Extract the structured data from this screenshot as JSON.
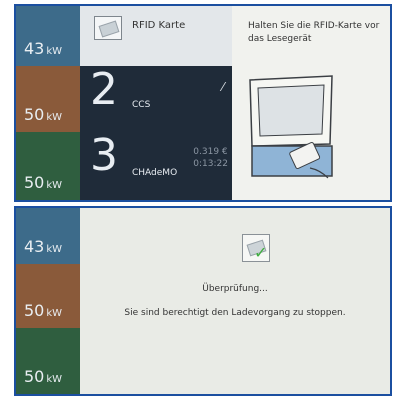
{
  "top": {
    "rows": [
      {
        "kw": "43",
        "unit": "kW",
        "color": "#3d6b8a"
      },
      {
        "kw": "50",
        "unit": "kW",
        "color": "#8a5a3a"
      },
      {
        "kw": "50",
        "unit": "kW",
        "color": "#2f5e3f"
      }
    ],
    "header_label": "RFID Karte",
    "connectors": [
      {
        "number": "2",
        "type": "CCS",
        "value": "⁄"
      },
      {
        "number": "3",
        "type": "CHAdeMO",
        "value": "0.319 €\n0:13:22"
      }
    ],
    "instruction": "Halten Sie die RFID-Karte vor\ndas Lesegerät"
  },
  "bottom": {
    "rows": [
      {
        "kw": "43",
        "unit": "kW",
        "color": "#3d6b8a"
      },
      {
        "kw": "50",
        "unit": "kW",
        "color": "#8a5a3a"
      },
      {
        "kw": "50",
        "unit": "kW",
        "color": "#2f5e3f"
      }
    ],
    "status": "Überprüfung...",
    "message": "Sie sind berechtigt den Ladevorgang zu stoppen."
  }
}
